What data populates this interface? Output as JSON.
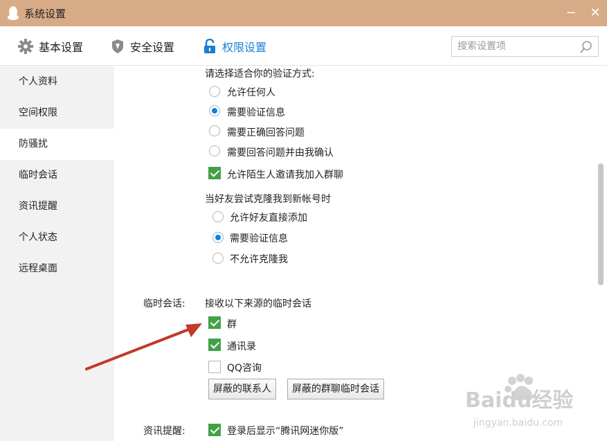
{
  "window": {
    "title": "系统设置",
    "minimize_glyph": "−",
    "close_glyph": "✕",
    "title_bar_color": "#d7ab86"
  },
  "toolbar": {
    "tabs": [
      {
        "label": "基本设置",
        "icon": "gear-icon",
        "active": false
      },
      {
        "label": "安全设置",
        "icon": "shield-icon",
        "active": false
      },
      {
        "label": "权限设置",
        "icon": "lock-icon",
        "active": true
      }
    ],
    "search_placeholder": "搜索设置项",
    "active_color": "#1a7fd4"
  },
  "sidebar": {
    "items": [
      {
        "label": "个人资料",
        "active": false
      },
      {
        "label": "空间权限",
        "active": false
      },
      {
        "label": "防骚扰",
        "active": true
      },
      {
        "label": "临时会话",
        "active": false
      },
      {
        "label": "资讯提醒",
        "active": false
      },
      {
        "label": "个人状态",
        "active": false
      },
      {
        "label": "远程桌面",
        "active": false
      }
    ]
  },
  "verification": {
    "heading": "请选择适合你的验证方式:",
    "options": [
      {
        "label": "允许任何人",
        "checked": false
      },
      {
        "label": "需要验证信息",
        "checked": true
      },
      {
        "label": "需要正确回答问题",
        "checked": false
      },
      {
        "label": "需要回答问题并由我确认",
        "checked": false
      }
    ],
    "allow_group_invite": {
      "label": "允许陌生人邀请我加入群聊",
      "checked": true
    }
  },
  "clone": {
    "heading": "当好友尝试克隆我到新帐号时",
    "options": [
      {
        "label": "允许好友直接添加",
        "checked": false
      },
      {
        "label": "需要验证信息",
        "checked": true
      },
      {
        "label": "不允许克隆我",
        "checked": false
      }
    ]
  },
  "temp_session": {
    "section_label": "临时会话:",
    "heading": "接收以下来源的临时会话",
    "options": [
      {
        "label": "群",
        "checked": true
      },
      {
        "label": "通讯录",
        "checked": true
      },
      {
        "label": "QQ咨询",
        "checked": false
      }
    ],
    "blocked_contacts_button": "屏蔽的联系人",
    "blocked_group_button": "屏蔽的群聊临时会话"
  },
  "news": {
    "section_label": "资讯提醒:",
    "show_mini": {
      "label": "登录后显示“腾讯网迷你版”",
      "checked": true
    }
  },
  "overlay": {
    "watermark_text": "Baidu经验",
    "watermark_sub": "jingyan.baidu.com",
    "arrow_color": "#c0392b"
  }
}
